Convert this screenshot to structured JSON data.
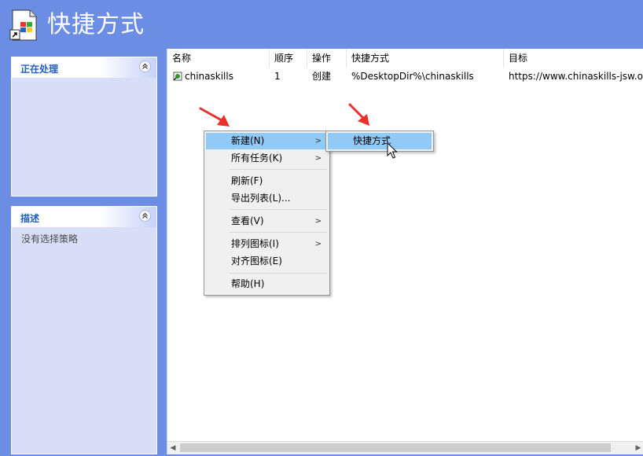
{
  "header": {
    "title": "快捷方式",
    "icon": "shortcut-wizard-icon"
  },
  "left_panels": [
    {
      "title": "正在处理",
      "body": ""
    },
    {
      "title": "描述",
      "body": "没有选择策略"
    }
  ],
  "table": {
    "columns": [
      "名称",
      "顺序",
      "操作",
      "快捷方式",
      "目标"
    ],
    "rows": [
      {
        "name": "chinaskills",
        "order": "1",
        "action": "创建",
        "shortcut": "%DesktopDir%\\chinaskills",
        "target": "https://www.chinaskills-jsw.or"
      }
    ]
  },
  "context_menu": {
    "items": [
      {
        "label": "新建(N)",
        "submenu": true,
        "highlighted": true
      },
      {
        "label": "所有任务(K)",
        "submenu": true
      },
      {
        "separator": true
      },
      {
        "label": "刷新(F)"
      },
      {
        "label": "导出列表(L)..."
      },
      {
        "separator": true
      },
      {
        "label": "查看(V)",
        "submenu": true
      },
      {
        "separator": true
      },
      {
        "label": "排列图标(I)",
        "submenu": true
      },
      {
        "label": "对齐图标(E)"
      },
      {
        "separator": true
      },
      {
        "label": "帮助(H)"
      }
    ]
  },
  "submenu": {
    "items": [
      {
        "label": "快捷方式",
        "highlighted": true
      }
    ]
  },
  "colors": {
    "background": "#6b8de3",
    "highlight": "#91c9f7",
    "panel": "#d6dff7",
    "panel_title": "#215dc6",
    "annotation_arrow": "#e8312a"
  }
}
